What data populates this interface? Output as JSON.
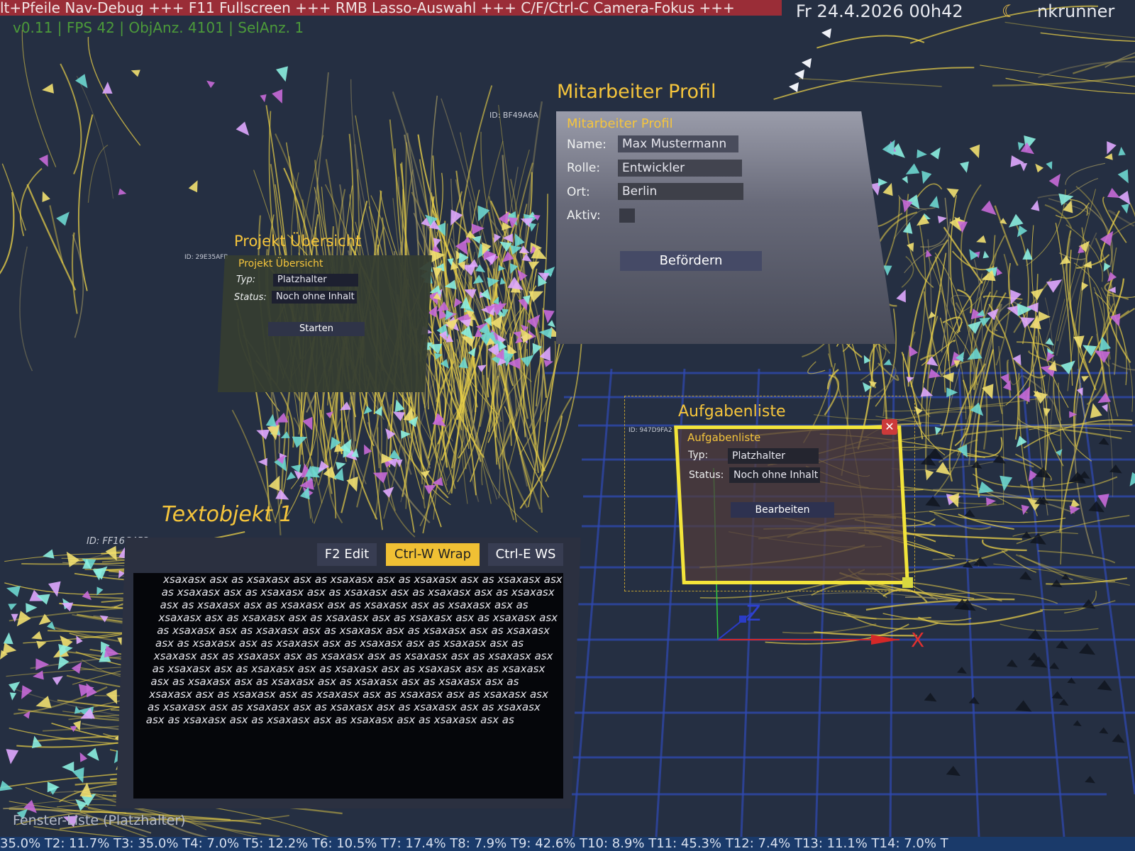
{
  "ticker": "lt+Pfeile Nav-Debug +++ F11 Fullscreen +++ RMB Lasso-Auswahl +++ C/F/Ctrl-C Camera-Fokus +++",
  "clock": "Fr 24.4.2026  00h42",
  "user": "nkrunner",
  "stats": "v0.11 | FPS 42 | ObjAnz. 4101 | SelAnz. 1",
  "colors": {
    "accent_title": "#f5c53c",
    "ticker_bg": "#9a2d37",
    "selection_border": "#f2e43a",
    "status_bar_bg": "#1a3a6a",
    "grid_line": "#2f4ab4"
  },
  "windows": {
    "project": {
      "title": "Projekt Übersicht",
      "id": "ID: 29E35AFB",
      "header": "Projekt Übersicht",
      "type_label": "Typ:",
      "type_value": "Platzhalter",
      "status_label": "Status:",
      "status_value": "Noch ohne Inhalt",
      "button": "Starten"
    },
    "employee": {
      "title": "Mitarbeiter Profil",
      "id": "ID: BF49A6A",
      "header": "Mitarbeiter Profil",
      "name_label": "Name:",
      "name_value": "Max Mustermann",
      "role_label": "Rolle:",
      "role_value": "Entwickler",
      "place_label": "Ort:",
      "place_value": "Berlin",
      "active_label": "Aktiv:",
      "active_checked": false,
      "button": "Befördern"
    },
    "tasks": {
      "title": "Aufgabenliste",
      "id": "ID: 947D9FA2",
      "header": "Aufgabenliste",
      "type_label": "Typ:",
      "type_value": "Platzhalter",
      "status_label": "Status:",
      "status_value": "Noch ohne Inhalt",
      "button": "Bearbeiten",
      "close_icon": "close-icon"
    },
    "text": {
      "title": "Textobjekt 1",
      "id": "ID: FF16C453",
      "btn_edit": "F2 Edit",
      "btn_wrap": "Ctrl-W Wrap",
      "btn_ws": "Ctrl-E WS",
      "lines": [
        "xsaxasx asx as xsaxasx asx as xsaxasx asx as xsaxasx asx as xsaxasx asx",
        "as xsaxasx asx as xsaxasx asx as xsaxasx asx as xsaxasx asx as xsaxasx",
        "asx as xsaxasx asx as xsaxasx asx as xsaxasx asx as xsaxasx asx as",
        "xsaxasx asx as xsaxasx asx as xsaxasx asx as xsaxasx asx as xsaxasx asx",
        "as xsaxasx asx as xsaxasx asx as xsaxasx asx as xsaxasx asx as xsaxasx",
        "asx as xsaxasx asx as xsaxasx asx as xsaxasx asx as xsaxasx asx as",
        "xsaxasx asx as xsaxasx asx as xsaxasx asx as xsaxasx asx as xsaxasx asx",
        "as xsaxasx asx as xsaxasx asx as xsaxasx asx as xsaxasx asx as xsaxasx",
        "asx as xsaxasx asx as xsaxasx asx as xsaxasx asx as xsaxasx asx as",
        "xsaxasx asx as xsaxasx asx as xsaxasx asx as xsaxasx asx as xsaxasx asx",
        "as xsaxasx asx as xsaxasx asx as xsaxasx asx as xsaxasx asx as xsaxasx",
        "asx as xsaxasx asx as xsaxasx asx as xsaxasx asx as xsaxasx asx as"
      ]
    }
  },
  "axes": {
    "x": "X",
    "z": "Z"
  },
  "footer_list": "Fenster-Liste (Platzhalter)",
  "statusbar": "35.0% T2:  11.7% T3:  35.0% T4:   7.0% T5:  12.2% T6:  10.5% T7:  17.4% T8:   7.9% T9:  42.6% T10:   8.9% T11:  45.3% T12:   7.4% T13:  11.1% T14:   7.0% T"
}
